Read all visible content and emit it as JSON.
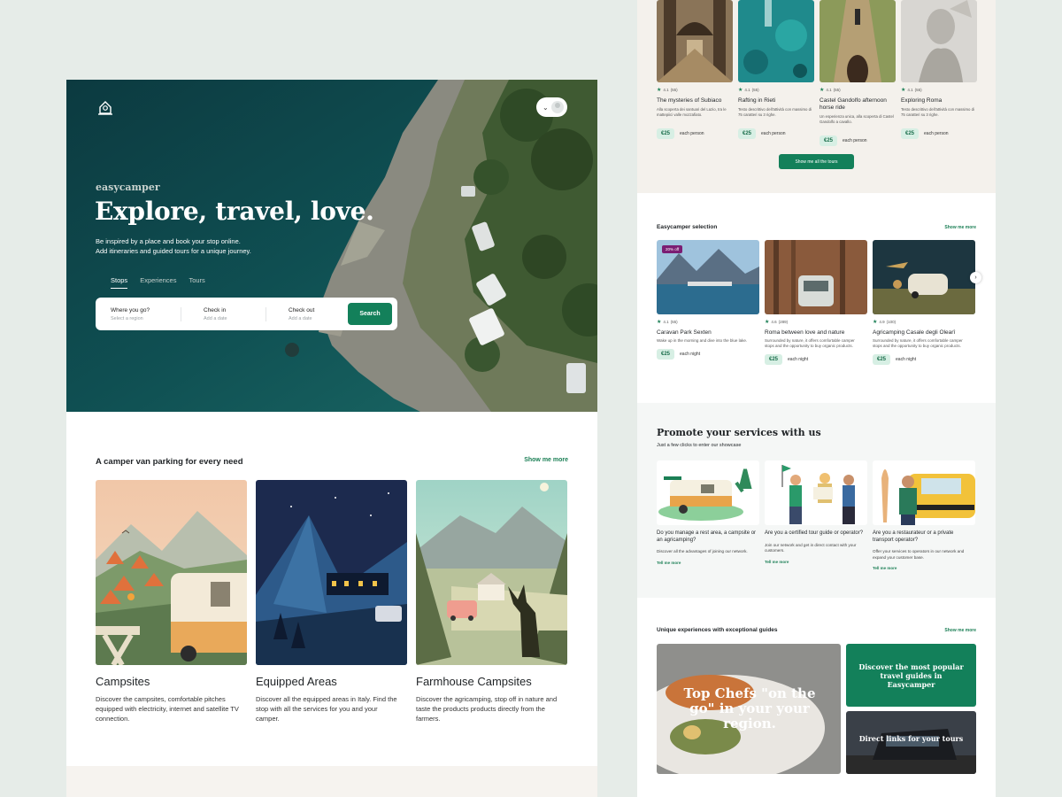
{
  "hero": {
    "brand": "easycamper",
    "headline": "Explore, travel, love.",
    "subline1": "Be inspired by a place and book your stop online.",
    "subline2": "Add itineraries and guided tours for a unique journey.",
    "tabs": [
      {
        "label": "Stops",
        "active": true
      },
      {
        "label": "Experiences"
      },
      {
        "label": "Tours"
      }
    ],
    "search": {
      "where_label": "Where you go?",
      "where_placeholder": "Select a region",
      "checkin_label": "Check in",
      "checkin_placeholder": "Add a date",
      "checkout_label": "Check out",
      "checkout_placeholder": "Add a date",
      "button": "Search"
    }
  },
  "parking": {
    "title": "A camper van parking for every need",
    "more": "Show me more",
    "cards": [
      {
        "title": "Campsites",
        "desc": "Discover the campsites, comfortable pitches equipped with electricity, internet and satellite TV connection."
      },
      {
        "title": "Equipped Areas",
        "desc": "Discover all the equipped areas in Italy. Find the stop with all the services for you and your camper."
      },
      {
        "title": "Farmhouse Campsites",
        "desc": "Discover the agricamping, stop off in nature and taste the products products directly from the farmers."
      }
    ]
  },
  "tours": {
    "items": [
      {
        "rating": "4.1",
        "count": "(55)",
        "name": "The mysteries of Subiaco",
        "desc": "Alla scoperta dei santuari del Lazio, tra le mattepiici valle mozzafiato.",
        "price": "€25",
        "unit": "each person"
      },
      {
        "rating": "4.1",
        "count": "(55)",
        "name": "Rafting in Rieti",
        "desc": "Testo descrittivo dell'attività con massimo di 75 caratteri su 3 righe.",
        "price": "€25",
        "unit": "each person"
      },
      {
        "rating": "4.1",
        "count": "(55)",
        "name": "Castel Gandolfo afternoon horse ride",
        "desc": "Un esperienza unica, alla scoperta di Castel Gandolfo a cavallo.",
        "price": "€25",
        "unit": "each person"
      },
      {
        "rating": "4.1",
        "count": "(55)",
        "name": "Exploring Roma",
        "desc": "Testo descrittivo dell'attività con massimo di 75 caratteri su 3 righe.",
        "price": "€25",
        "unit": "each person"
      }
    ],
    "button": "Show me all the tours"
  },
  "selection": {
    "title": "Easycamper selection",
    "more": "Show me more",
    "items": [
      {
        "badge": "20% off",
        "rating": "4.1",
        "count": "(55)",
        "name": "Caravan Park Sexten",
        "desc": "Wake up in the morning and dive into the blue lake.",
        "price": "€25",
        "unit": "each night"
      },
      {
        "rating": "4.6",
        "count": "(289)",
        "name": "Roma between love and nature",
        "desc": "Surrounded by nature, it offers comfortable camper stops and the opportunity to buy organic products.",
        "price": "€25",
        "unit": "each night"
      },
      {
        "rating": "4.9",
        "count": "(100)",
        "name": "Agricamping Casale degli Olearî",
        "desc": "Surrounded by nature, it offers comfortable camper stops and the opportunity to buy organic products.",
        "price": "€25",
        "unit": "each night"
      }
    ]
  },
  "promote": {
    "title": "Promote your services with us",
    "subtitle": "Just a few clicks to enter our showcase",
    "items": [
      {
        "q": "Do you manage a rest area, a campsite or an agricamping?",
        "desc": "Discover all the advantages of joining our network.",
        "more": "Tell me more"
      },
      {
        "q": "Are you a certified tour guide or operator?",
        "desc": "Join our network and get in direct contact with your customers.",
        "more": "Tell me more"
      },
      {
        "q": "Are you a restaurateur or a private transport operator?",
        "desc": "Offer your services to operators in our network and expand your customer base.",
        "more": "Tell me more"
      }
    ]
  },
  "guides": {
    "title": "Unique experiences with exceptional guides",
    "more": "Show me more",
    "big": "Top Chefs \"on the go\" in your your region.",
    "popular": "Discover the most popular travel guides in Easycamper",
    "links": "Direct links for your tours"
  },
  "colors": {
    "accent": "#13805a",
    "badge": "#7b1d73",
    "bg": "#e6ece8"
  }
}
